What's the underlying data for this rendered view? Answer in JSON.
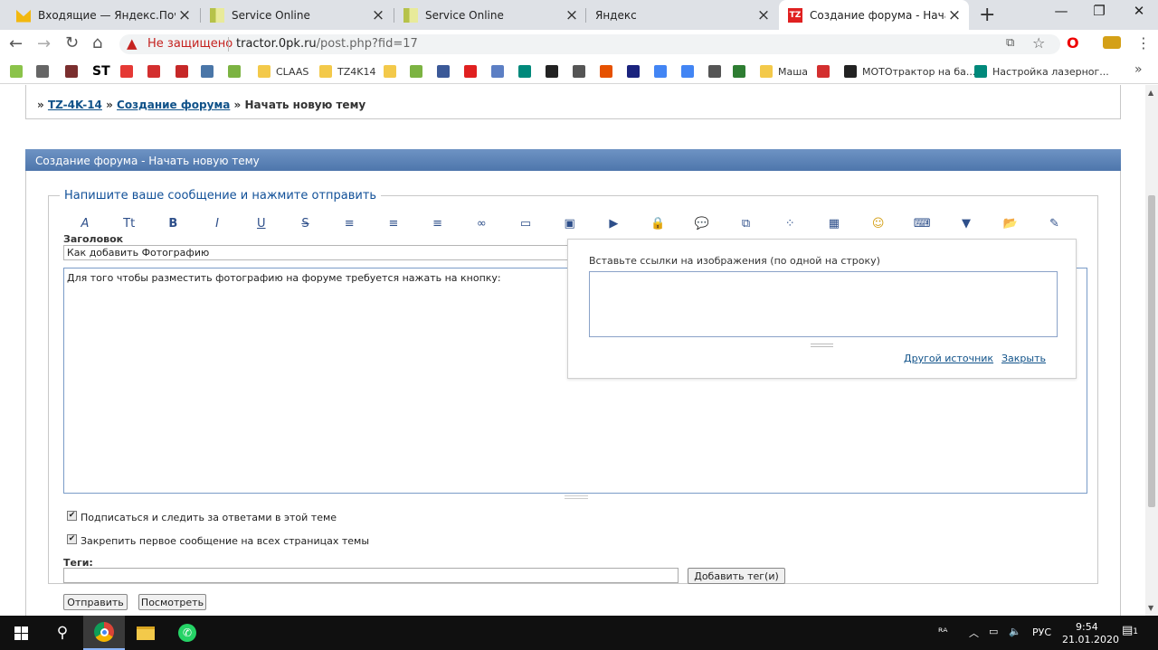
{
  "browser": {
    "tabs": [
      {
        "title": "Входящие — Яндекс.Почта",
        "icon": "yandex-mail-icon",
        "color": "#f2b80f"
      },
      {
        "title": "Service Online",
        "icon": "service-online-icon",
        "color": "#c9d46a"
      },
      {
        "title": "Service Online",
        "icon": "service-online-icon",
        "color": "#c9d46a"
      },
      {
        "title": "Яндекс",
        "icon": "yandex-icon",
        "color": "#ffffff"
      },
      {
        "title": "Создание форума - Начать нову",
        "icon": "tz-icon",
        "color": "#e02020",
        "active": true
      }
    ],
    "new_tab": "+",
    "window": {
      "minimize": "—",
      "maximize": "❐",
      "close": "✕"
    },
    "address": {
      "warning": "Не защищено",
      "host": "tractor.0pk.ru",
      "path": "/post.php?fid=17"
    },
    "bookmarks": [
      {
        "label": "",
        "icon": "bookmark-green-icon",
        "color": "#8bc34a"
      },
      {
        "label": "",
        "icon": "bookmark-eagle-icon",
        "color": "#666666"
      },
      {
        "label": "",
        "icon": "bookmark-w-icon",
        "color": "#7a2e2e"
      },
      {
        "label": "ST",
        "icon": "bookmark-st-icon",
        "color": "#000000"
      },
      {
        "label": "",
        "icon": "bookmark-lifebuoy-icon",
        "color": "#e53935"
      },
      {
        "label": "",
        "icon": "bookmark-arrows-icon",
        "color": "#d32f2f"
      },
      {
        "label": "",
        "icon": "bookmark-s-icon",
        "color": "#c62828"
      },
      {
        "label": "",
        "icon": "bookmark-vk-icon",
        "color": "#4a76a8"
      },
      {
        "label": "",
        "icon": "bookmark-dots-icon",
        "color": "#7cb342"
      },
      {
        "label": "CLAAS",
        "icon": "folder-icon",
        "color": "#f3c94a"
      },
      {
        "label": "TZ4K14",
        "icon": "folder-icon",
        "color": "#f3c94a"
      },
      {
        "label": "",
        "icon": "folder-icon",
        "color": "#f3c94a"
      },
      {
        "label": "",
        "icon": "bookmark-apple-icon",
        "color": "#7cb342"
      },
      {
        "label": "",
        "icon": "bookmark-facebook-icon",
        "color": "#3b5998"
      },
      {
        "label": "",
        "icon": "bookmark-tz-icon",
        "color": "#e02020"
      },
      {
        "label": "",
        "icon": "bookmark-diamond-icon",
        "color": "#5c7fc4"
      },
      {
        "label": "",
        "icon": "bookmark-m-icon",
        "color": "#00897b"
      },
      {
        "label": "",
        "icon": "bookmark-x-icon",
        "color": "#222222"
      },
      {
        "label": "",
        "icon": "bookmark-globe-icon",
        "color": "#555555"
      },
      {
        "label": "",
        "icon": "bookmark-colorful-icon",
        "color": "#e65100"
      },
      {
        "label": "",
        "icon": "bookmark-sm-icon",
        "color": "#1a237e"
      },
      {
        "label": "",
        "icon": "bookmark-google-icon",
        "color": "#4285f4"
      },
      {
        "label": "",
        "icon": "bookmark-translate-icon",
        "color": "#4285f4"
      },
      {
        "label": "",
        "icon": "bookmark-globe2-icon",
        "color": "#555555"
      },
      {
        "label": "",
        "icon": "bookmark-tractor-icon",
        "color": "#2e7d32"
      },
      {
        "label": "Маша",
        "icon": "folder-icon",
        "color": "#f3c94a"
      },
      {
        "label": "",
        "icon": "bookmark-flag-icon",
        "color": "#d32f2f"
      },
      {
        "label": "МОТОтрактор на ба...",
        "icon": "bookmark-moto-icon",
        "color": "#222222"
      },
      {
        "label": "Настройка лазерног...",
        "icon": "bookmark-m-icon",
        "color": "#00897b"
      }
    ],
    "bookmarks_more": "»"
  },
  "page": {
    "breadcrumb": {
      "sep": "»",
      "items": [
        "TZ-4K-14",
        "Создание форума",
        "Начать новую тему"
      ]
    },
    "panel_title": "Создание форума - Начать новую тему",
    "legend": "Напишите ваше сообщение и нажмите отправить",
    "toolbar": [
      {
        "name": "font-icon",
        "glyph": "A"
      },
      {
        "name": "font-size-icon",
        "glyph": "Tt"
      },
      {
        "name": "bold-icon",
        "glyph": "B"
      },
      {
        "name": "italic-icon",
        "glyph": "I"
      },
      {
        "name": "underline-icon",
        "glyph": "U"
      },
      {
        "name": "strikethrough-icon",
        "glyph": "S"
      },
      {
        "name": "align-left-icon",
        "glyph": "≡"
      },
      {
        "name": "align-center-icon",
        "glyph": "≡"
      },
      {
        "name": "align-right-icon",
        "glyph": "≡"
      },
      {
        "name": "link-icon",
        "glyph": "∞"
      },
      {
        "name": "book-icon",
        "glyph": "▭"
      },
      {
        "name": "image-icon",
        "glyph": "▣"
      },
      {
        "name": "video-icon",
        "glyph": "▶"
      },
      {
        "name": "lock-icon",
        "glyph": "🔒"
      },
      {
        "name": "quote-icon",
        "glyph": "💬"
      },
      {
        "name": "code-icon",
        "glyph": "⧉"
      },
      {
        "name": "color-icon",
        "glyph": "⁘"
      },
      {
        "name": "table-icon",
        "glyph": "▦"
      },
      {
        "name": "smiley-icon",
        "glyph": "☺"
      },
      {
        "name": "keyboard-icon",
        "glyph": "⌨"
      },
      {
        "name": "dropdown-arrow-icon",
        "glyph": "▼"
      },
      {
        "name": "folder-icon",
        "glyph": "📂"
      },
      {
        "name": "edit-icon",
        "glyph": "✎"
      }
    ],
    "subject_label": "Заголовок",
    "subject_value": "Как добавить Фотографию",
    "message_text": "Для того чтобы разместить фотографию на форуме требуется нажать на кнопку:",
    "popup": {
      "label": "Вставьте ссылки на изображения (по одной на строку)",
      "other_source": "Другой источник",
      "close": "Закрыть"
    },
    "checkbox_subscribe": "Подписаться и следить за ответами в этой теме",
    "checkbox_pin": "Закрепить первое сообщение на всех страницах темы",
    "tags_label": "Теги:",
    "add_tags_button": "Добавить тег(и)",
    "submit_button": "Отправить",
    "preview_button": "Посмотреть"
  },
  "taskbar": {
    "tray_lang": "РУС",
    "time": "9:54",
    "date": "21.01.2020",
    "notifications": "1"
  }
}
